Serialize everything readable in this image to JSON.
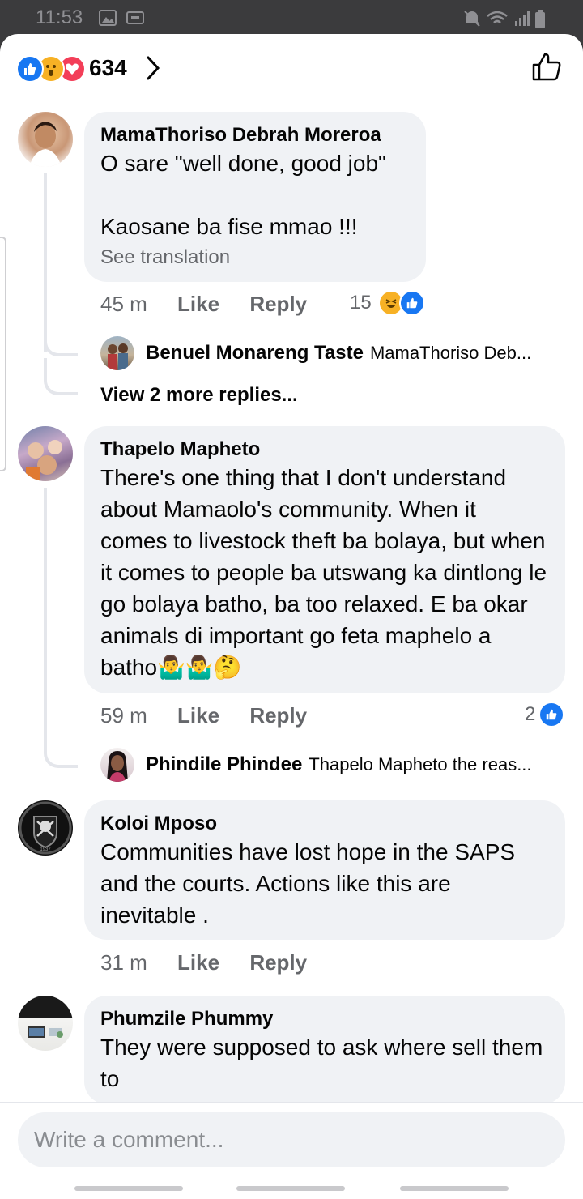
{
  "status_bar": {
    "time": "11:53"
  },
  "header": {
    "reaction_count": "634"
  },
  "comments": [
    {
      "author": "MamaThoriso Debrah Moreroa",
      "text": "O sare \"well done, good job\"\n\nKaosane ba fise mmao !!!",
      "see_translation": "See translation",
      "time": "45 m",
      "like": "Like",
      "reply": "Reply",
      "reaction_count": "15",
      "reply_preview": {
        "author": "Benuel Monareng Taste",
        "text": "MamaThoriso Deb..."
      },
      "more_replies": "View 2 more replies..."
    },
    {
      "author": "Thapelo Mapheto",
      "text": "There's one thing that I don't understand about Mamaolo's community. When it comes to livestock theft ba bolaya, but when it comes to people ba utswang ka dintlong le go bolaya batho, ba too relaxed. E ba okar animals di important go feta maphelo a batho🤷‍♂️🤷‍♂️🤔",
      "time": "59 m",
      "like": "Like",
      "reply": "Reply",
      "reaction_count": "2",
      "reply_preview": {
        "author": "Phindile Phindee",
        "text": "Thapelo Mapheto the reas..."
      }
    },
    {
      "author": "Koloi Mposo",
      "text": "Communities have lost hope in the SAPS and the courts. Actions like this are inevitable .",
      "time": "31 m",
      "like": "Like",
      "reply": "Reply"
    },
    {
      "author": "Phumzile Phummy",
      "text": "They were supposed to ask where sell them to"
    }
  ],
  "composer": {
    "placeholder": "Write a comment..."
  },
  "colors": {
    "facebook_blue": "#1877f2",
    "love_red": "#f33e58",
    "haha_yellow": "#f7b125",
    "bubble_gray": "#f0f2f5"
  }
}
